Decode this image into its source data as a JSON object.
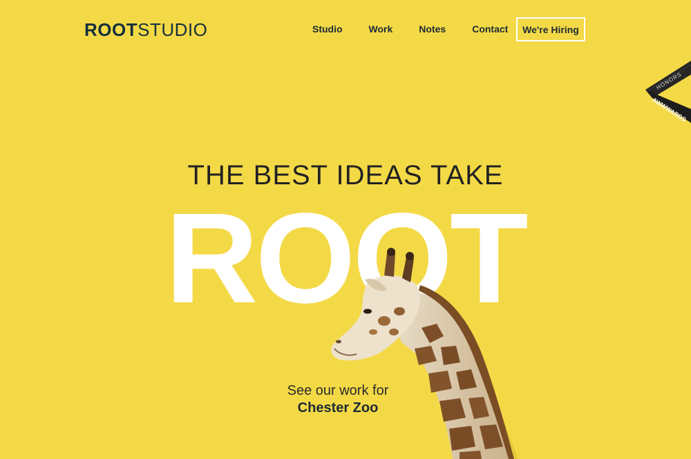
{
  "brand": {
    "logo_bold": "ROOT",
    "logo_light": "STUDIO"
  },
  "nav": {
    "items": [
      {
        "label": "Studio"
      },
      {
        "label": "Work"
      },
      {
        "label": "Notes"
      },
      {
        "label": "Contact"
      }
    ],
    "cta_label": "We're Hiring"
  },
  "badge": {
    "line1": "HONORS",
    "line2": "AWWWARDS"
  },
  "hero": {
    "tagline": "THE BEST IDEAS TAKE",
    "headline": "ROOT",
    "cta_text": "See our work for",
    "cta_link": "Chester Zoo"
  },
  "colors": {
    "background": "#f4d947",
    "headline": "#ffffff",
    "text": "#1b2a35"
  }
}
